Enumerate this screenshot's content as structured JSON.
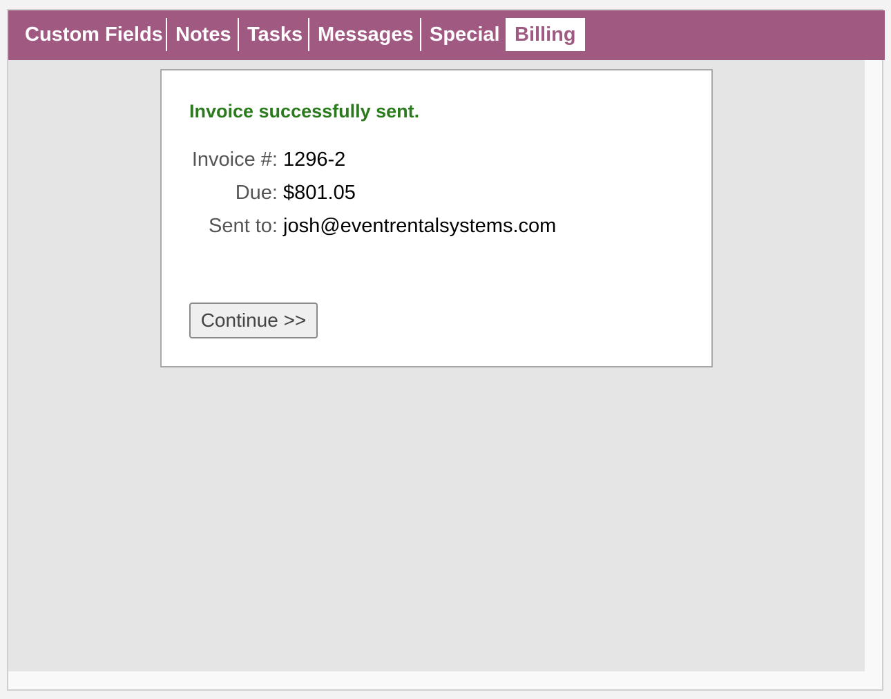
{
  "tabs": [
    {
      "label": "Custom Fields",
      "active": false
    },
    {
      "label": "Notes",
      "active": false
    },
    {
      "label": "Tasks",
      "active": false
    },
    {
      "label": "Messages",
      "active": false
    },
    {
      "label": "Special",
      "active": false
    },
    {
      "label": "Billing",
      "active": true
    }
  ],
  "dialog": {
    "message": "Invoice successfully sent.",
    "fields": [
      {
        "label": "Invoice #:",
        "value": "1296-2"
      },
      {
        "label": "Due:",
        "value": "$801.05"
      },
      {
        "label": "Sent to:",
        "value": "josh@eventrentalsystems.com"
      }
    ],
    "continue_label": "Continue >>"
  },
  "colors": {
    "tab_bar": "#a05a82",
    "success_text": "#2c7a1e"
  }
}
